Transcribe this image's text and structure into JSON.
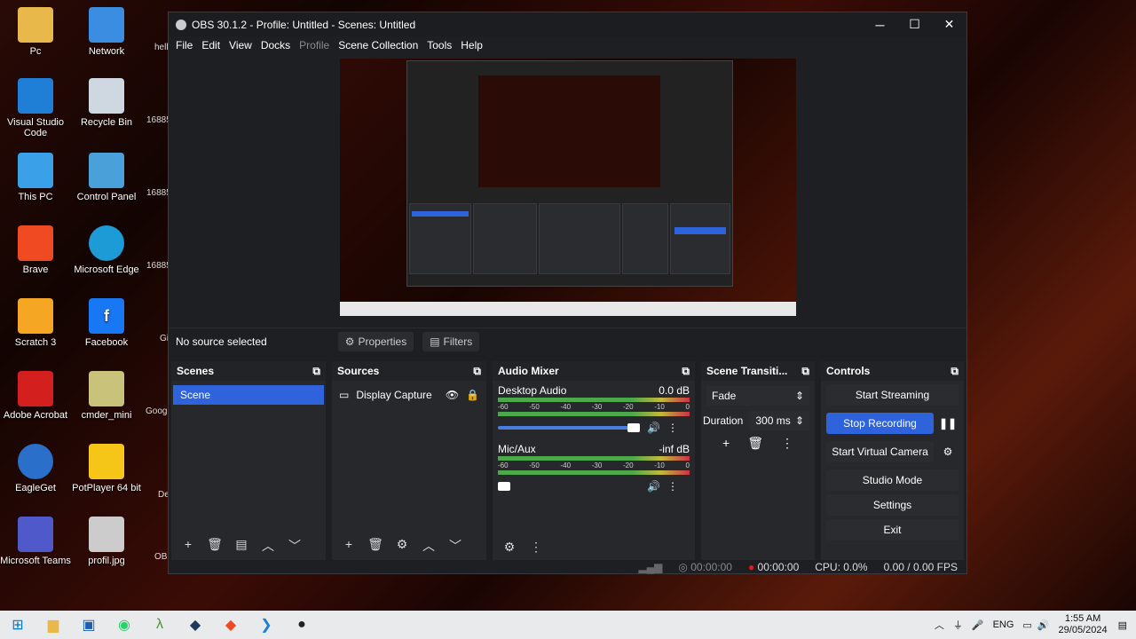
{
  "desktop": {
    "icons": [
      "Pc",
      "Network",
      "Visual Studio Code",
      "Recycle Bin",
      "This PC",
      "Control Panel",
      "Brave",
      "Microsoft Edge",
      "Scratch 3",
      "Facebook",
      "Adobe Acrobat",
      "cmder_mini",
      "EagleGet",
      "PotPlayer 64 bit",
      "Microsoft Teams",
      "profil.jpg"
    ],
    "partial": [
      "hell",
      "16885",
      "16885",
      "16885",
      "Gi",
      "Goog",
      "De",
      "OBS"
    ]
  },
  "window": {
    "title": "OBS 30.1.2 - Profile: Untitled - Scenes: Untitled",
    "minimize": "─",
    "maximize": "☐",
    "close": "✕"
  },
  "menu": [
    "File",
    "Edit",
    "View",
    "Docks",
    "Profile",
    "Scene Collection",
    "Tools",
    "Help"
  ],
  "context": {
    "no_source": "No source selected",
    "properties": "Properties",
    "filters": "Filters"
  },
  "scenes": {
    "title": "Scenes",
    "items": [
      "Scene"
    ]
  },
  "sources": {
    "title": "Sources",
    "items": [
      "Display Capture"
    ]
  },
  "mixer": {
    "title": "Audio Mixer",
    "channels": [
      {
        "name": "Desktop Audio",
        "level": "0.0 dB",
        "volume": 0.85
      },
      {
        "name": "Mic/Aux",
        "level": "-inf dB",
        "volume": 0.05
      }
    ],
    "scale": [
      "-60",
      "-55",
      "-50",
      "-45",
      "-40",
      "-35",
      "-30",
      "-25",
      "-20",
      "-15",
      "-10",
      "-5",
      "0"
    ]
  },
  "transitions": {
    "title": "Scene Transiti...",
    "type": "Fade",
    "duration_label": "Duration",
    "duration": "300 ms"
  },
  "controls": {
    "title": "Controls",
    "buttons": [
      "Start Streaming",
      "Stop Recording",
      "Start Virtual Camera",
      "Studio Mode",
      "Settings",
      "Exit"
    ]
  },
  "status": {
    "stream_time": "00:00:00",
    "rec_time": "00:00:00",
    "cpu": "CPU: 0.0%",
    "fps": "0.00 / 0.00 FPS"
  },
  "taskbar": {
    "lang": "ENG",
    "time": "1:55 AM",
    "date": "29/05/2024"
  }
}
